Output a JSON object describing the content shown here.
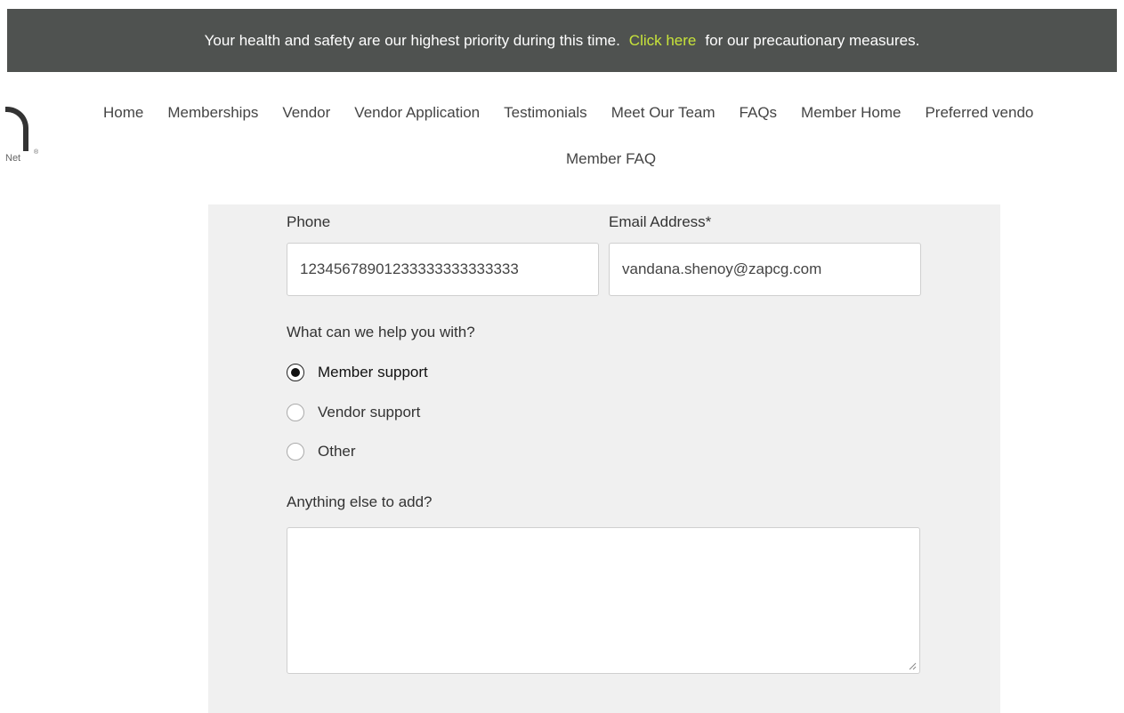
{
  "banner": {
    "text_before": "Your health and safety are our highest priority during this time.",
    "link_text": "Click here",
    "text_after": "for our precautionary measures.",
    "link_color": "#c7e33a",
    "background": "#4f5250"
  },
  "logo": {
    "text": "Net",
    "reg": "®"
  },
  "nav": {
    "items": [
      "Home",
      "Memberships",
      "Vendor",
      "Vendor Application",
      "Testimonials",
      "Meet Our Team",
      "FAQs",
      "Member Home",
      "Preferred vendo"
    ],
    "row2": "Member FAQ"
  },
  "form": {
    "phone_label": "Phone",
    "phone_value": "12345678901233333333333333",
    "email_label": "Email Address*",
    "email_value": "vandana.shenoy@zapcg.com",
    "help_label": "What can we help you with?",
    "options": [
      {
        "label": "Member support",
        "selected": true
      },
      {
        "label": "Vendor support",
        "selected": false
      },
      {
        "label": "Other",
        "selected": false
      }
    ],
    "extra_label": "Anything else to add?",
    "extra_value": ""
  }
}
